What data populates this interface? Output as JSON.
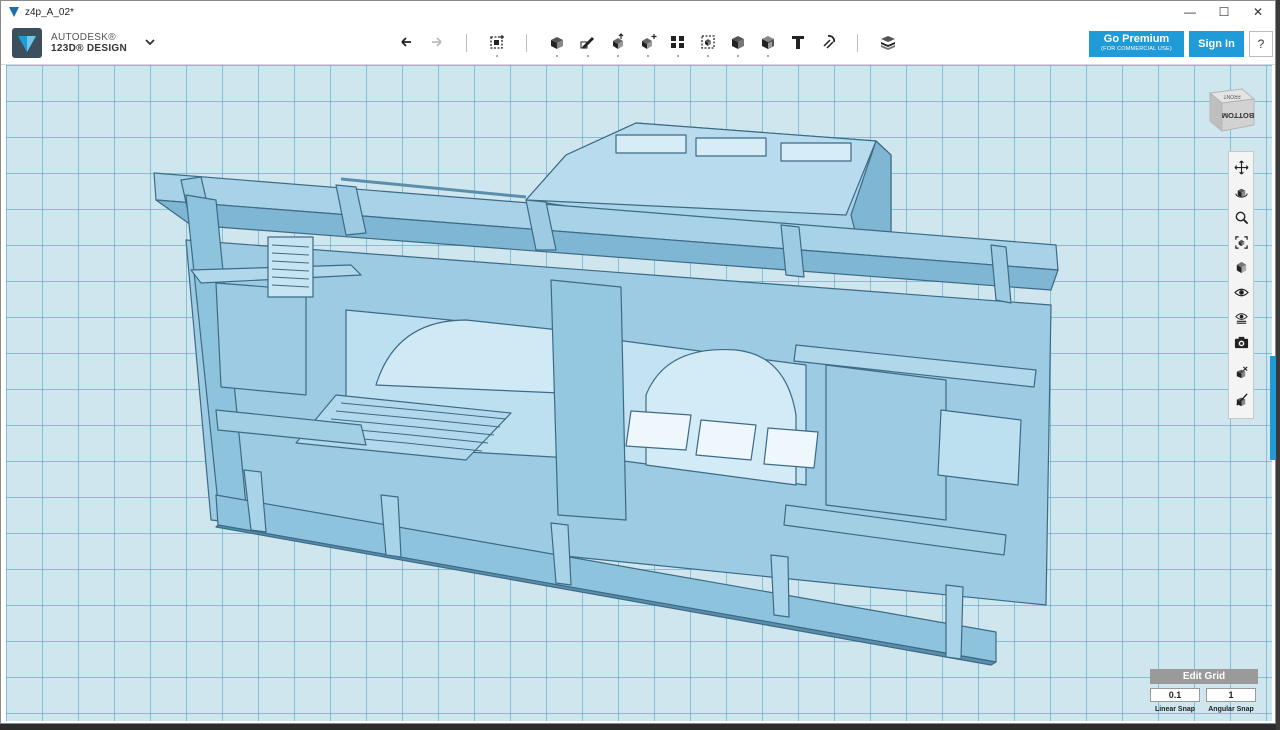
{
  "window": {
    "title": "z4p_A_02*",
    "controls": {
      "minimize": "—",
      "maximize": "☐",
      "close": "✕"
    }
  },
  "app": {
    "brand_line1": "AUTODESK®",
    "brand_line2": "123D® DESIGN"
  },
  "toolbar": {
    "tools": [
      {
        "name": "undo-icon"
      },
      {
        "name": "redo-icon"
      },
      {
        "name": "transform-icon"
      },
      {
        "name": "primitives-icon"
      },
      {
        "name": "sketch-icon"
      },
      {
        "name": "construct-icon"
      },
      {
        "name": "modify-icon"
      },
      {
        "name": "pattern-icon"
      },
      {
        "name": "group-icon"
      },
      {
        "name": "combine-icon"
      },
      {
        "name": "measure-icon"
      },
      {
        "name": "text-icon"
      },
      {
        "name": "snap-icon"
      },
      {
        "name": "material-icon"
      }
    ],
    "premium_label": "Go Premium",
    "premium_sublabel": "(FOR COMMERCIAL USE)",
    "signin_label": "Sign In",
    "help_label": "?"
  },
  "viewcube": {
    "face_label": "BOTTOM",
    "top_label": "FRONT"
  },
  "navbar": {
    "items": [
      {
        "name": "pan-icon"
      },
      {
        "name": "orbit-icon"
      },
      {
        "name": "zoom-icon"
      },
      {
        "name": "fit-icon"
      },
      {
        "name": "view-mode-icon"
      },
      {
        "name": "visibility-icon"
      },
      {
        "name": "material-view-icon"
      },
      {
        "name": "screenshot-icon"
      },
      {
        "name": "snap-tool-icon"
      },
      {
        "name": "solid-snap-icon"
      }
    ]
  },
  "grid": {
    "edit_label": "Edit Grid",
    "linear_snap_value": "0.1",
    "angular_snap_value": "1",
    "linear_snap_label": "Linear Snap",
    "angular_snap_label": "Angular Snap"
  },
  "colors": {
    "accent": "#1f9bd7",
    "model_fill": "#8cc4e0",
    "model_edge": "#3d6a86",
    "grid_bg": "#cfe6ee"
  }
}
